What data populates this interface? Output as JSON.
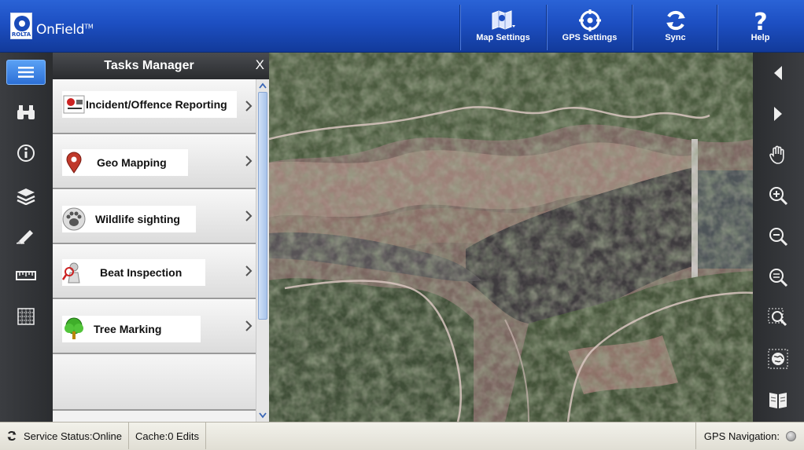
{
  "header": {
    "logo_brand": "ROLTA",
    "logo_app": "OnField",
    "logo_tm": "TM",
    "buttons": [
      {
        "label": "Map Settings",
        "icon": "map-settings-icon"
      },
      {
        "label": "GPS Settings",
        "icon": "gps-crosshair-icon"
      },
      {
        "label": "Sync",
        "icon": "sync-icon"
      },
      {
        "label": "Help",
        "icon": "help-icon"
      }
    ]
  },
  "left_toolbar": {
    "tools": [
      "menu-icon",
      "binoculars-icon",
      "info-icon",
      "layers-icon",
      "pen-icon",
      "ruler-icon",
      "grid-icon"
    ]
  },
  "tasks": {
    "title": "Tasks Manager",
    "close": "X",
    "items": [
      {
        "label": "Incident/Offence Reporting",
        "icon": "incident-report-icon"
      },
      {
        "label": "Geo Mapping",
        "icon": "map-pin-icon"
      },
      {
        "label": "Wildlife sighting",
        "icon": "paw-icon"
      },
      {
        "label": "Beat Inspection",
        "icon": "inspection-icon"
      },
      {
        "label": "Tree Marking",
        "icon": "tree-icon"
      }
    ]
  },
  "right_toolbar": {
    "tools": [
      "arrow-left-icon",
      "arrow-right-icon",
      "pan-hand-icon",
      "zoom-in-icon",
      "zoom-out-icon",
      "zoom-full-icon",
      "zoom-window-icon",
      "globe-extent-icon",
      "bookmark-book-icon"
    ]
  },
  "status": {
    "service": "Service Status:Online",
    "cache": "Cache:0 Edits",
    "gps": "GPS Navigation:"
  },
  "colors": {
    "header_blue": "#1d4fc2",
    "toolbar_dark": "#333538",
    "menu_active": "#3f86e6"
  }
}
